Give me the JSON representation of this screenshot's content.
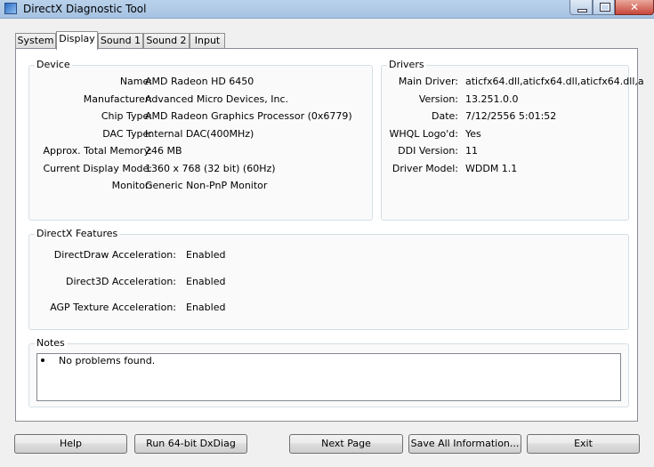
{
  "window": {
    "title": "DirectX Diagnostic Tool",
    "close_glyph": "✕"
  },
  "tabs": [
    "System",
    "Display",
    "Sound 1",
    "Sound 2",
    "Input"
  ],
  "device": {
    "heading": "Device",
    "fields": [
      {
        "label": "Name:",
        "value": "AMD Radeon HD 6450"
      },
      {
        "label": "Manufacturer:",
        "value": "Advanced Micro Devices, Inc."
      },
      {
        "label": "Chip Type:",
        "value": "AMD Radeon Graphics Processor (0x6779)"
      },
      {
        "label": "DAC Type:",
        "value": "Internal DAC(400MHz)"
      },
      {
        "label": "Approx. Total Memory:",
        "value": "246 MB"
      },
      {
        "label": "Current Display Mode:",
        "value": "1360 x 768 (32 bit) (60Hz)"
      },
      {
        "label": "Monitor:",
        "value": "Generic Non-PnP Monitor"
      }
    ]
  },
  "drivers": {
    "heading": "Drivers",
    "fields": [
      {
        "label": "Main Driver:",
        "value": "aticfx64.dll,aticfx64.dll,aticfx64.dll,a"
      },
      {
        "label": "Version:",
        "value": "13.251.0.0"
      },
      {
        "label": "Date:",
        "value": "7/12/2556 5:01:52"
      },
      {
        "label": "WHQL Logo'd:",
        "value": "Yes"
      },
      {
        "label": "DDI Version:",
        "value": "11"
      },
      {
        "label": "Driver Model:",
        "value": "WDDM 1.1"
      }
    ]
  },
  "features": {
    "heading": "DirectX Features",
    "fields": [
      {
        "label": "DirectDraw Acceleration:",
        "value": "Enabled"
      },
      {
        "label": "Direct3D Acceleration:",
        "value": "Enabled"
      },
      {
        "label": "AGP Texture Acceleration:",
        "value": "Enabled"
      }
    ]
  },
  "notes": {
    "heading": "Notes",
    "items": [
      "No problems found."
    ]
  },
  "buttons": {
    "help": "Help",
    "run64": "Run 64-bit DxDiag",
    "next": "Next Page",
    "save": "Save All Information...",
    "exit": "Exit"
  }
}
